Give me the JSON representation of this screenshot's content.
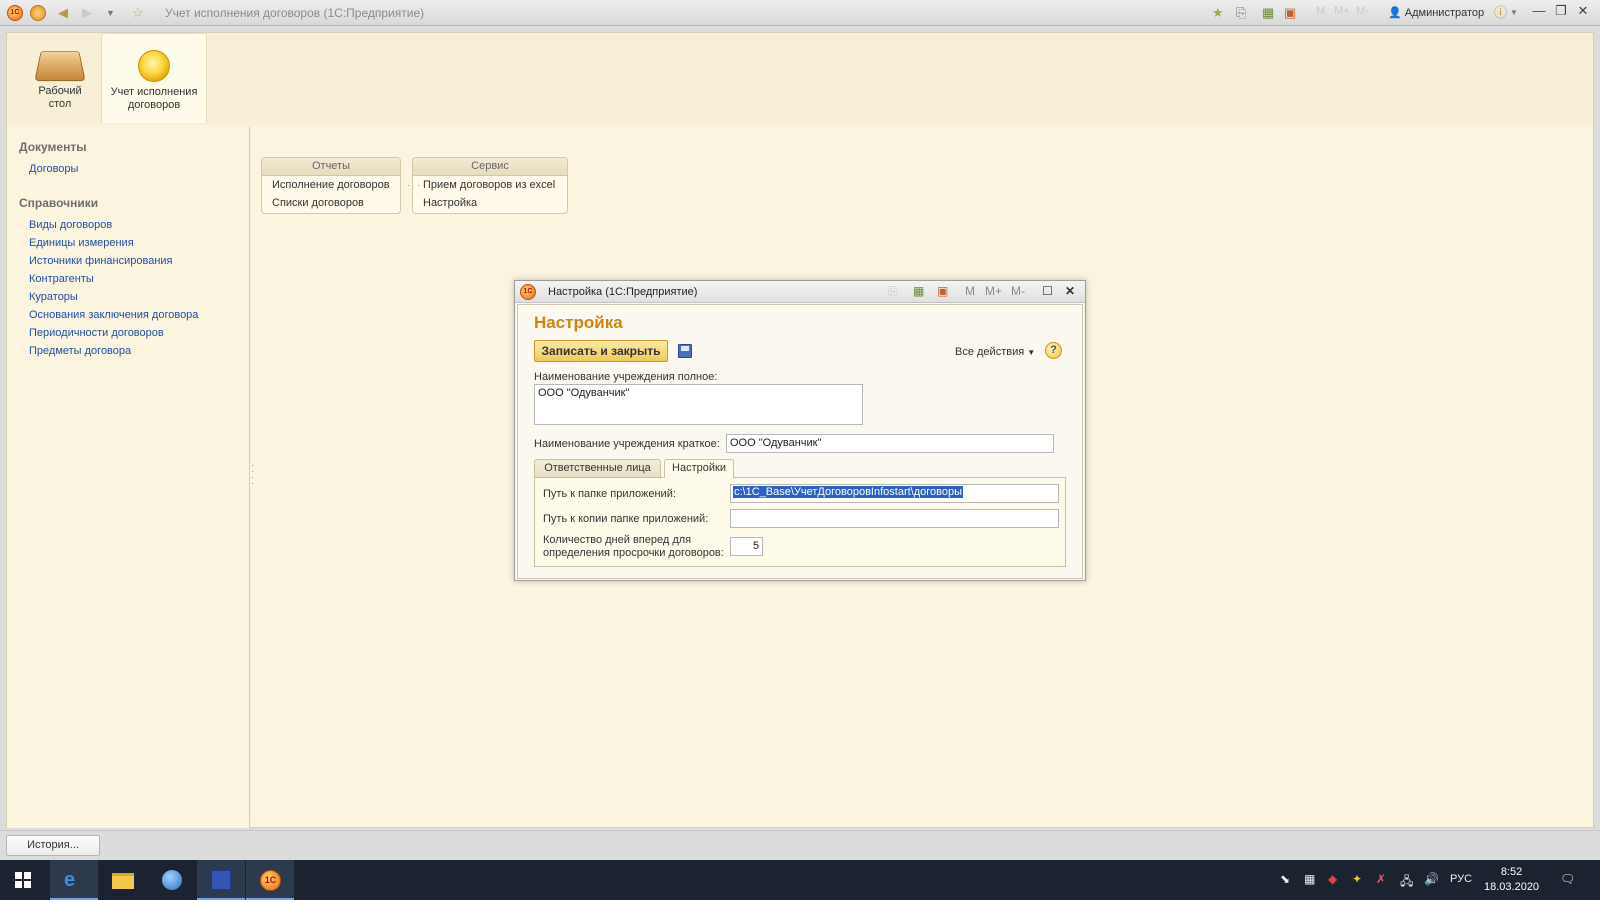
{
  "window": {
    "title": "Учет исполнения договоров  (1С:Предприятие)",
    "user": "Администратор",
    "calc_m": "M",
    "calc_mplus": "M+",
    "calc_mminus": "M-"
  },
  "sections": [
    {
      "label": "Рабочий стол"
    },
    {
      "label": "Учет исполнения договоров"
    }
  ],
  "nav": {
    "groups": [
      {
        "title": "Документы",
        "items": [
          "Договоры"
        ]
      },
      {
        "title": "Справочники",
        "items": [
          "Виды договоров",
          "Единицы измерения",
          "Источники финансирования",
          "Контрагенты",
          "Кураторы",
          "Основания заключения договора",
          "Периодичности договоров",
          "Предметы договора"
        ]
      }
    ]
  },
  "commands": [
    {
      "title": "Отчеты",
      "items": [
        "Исполнение договоров",
        "Списки договоров"
      ]
    },
    {
      "title": "Сервис",
      "items": [
        "Прием договоров из excel",
        "Настройка"
      ]
    }
  ],
  "dialog": {
    "title": "Настройка  (1С:Предприятие)",
    "form_title": "Настройка",
    "save_close": "Записать и закрыть",
    "all_actions": "Все действия",
    "help": "?",
    "full_name_label": "Наименование учреждения полное:",
    "full_name_value": "ООО \"Одуванчик\"",
    "short_name_label": "Наименование учреждения краткое:",
    "short_name_value": "ООО \"Одуванчик\"",
    "tabs": [
      "Ответственные лица",
      "Настройки"
    ],
    "app_folder_label": "Путь к папке приложений:",
    "app_folder_value": "c:\\1C_Base\\УчетДоговоровInfostart\\договоры",
    "copy_folder_label": "Путь к копии папке приложений:",
    "copy_folder_value": "",
    "days_label_1": "Количество дней вперед для",
    "days_label_2": "определения просрочки договоров:",
    "days_value": "5"
  },
  "status": {
    "history_button": "История..."
  },
  "taskbar": {
    "lang": "РУС",
    "time": "8:52",
    "date": "18.03.2020"
  }
}
